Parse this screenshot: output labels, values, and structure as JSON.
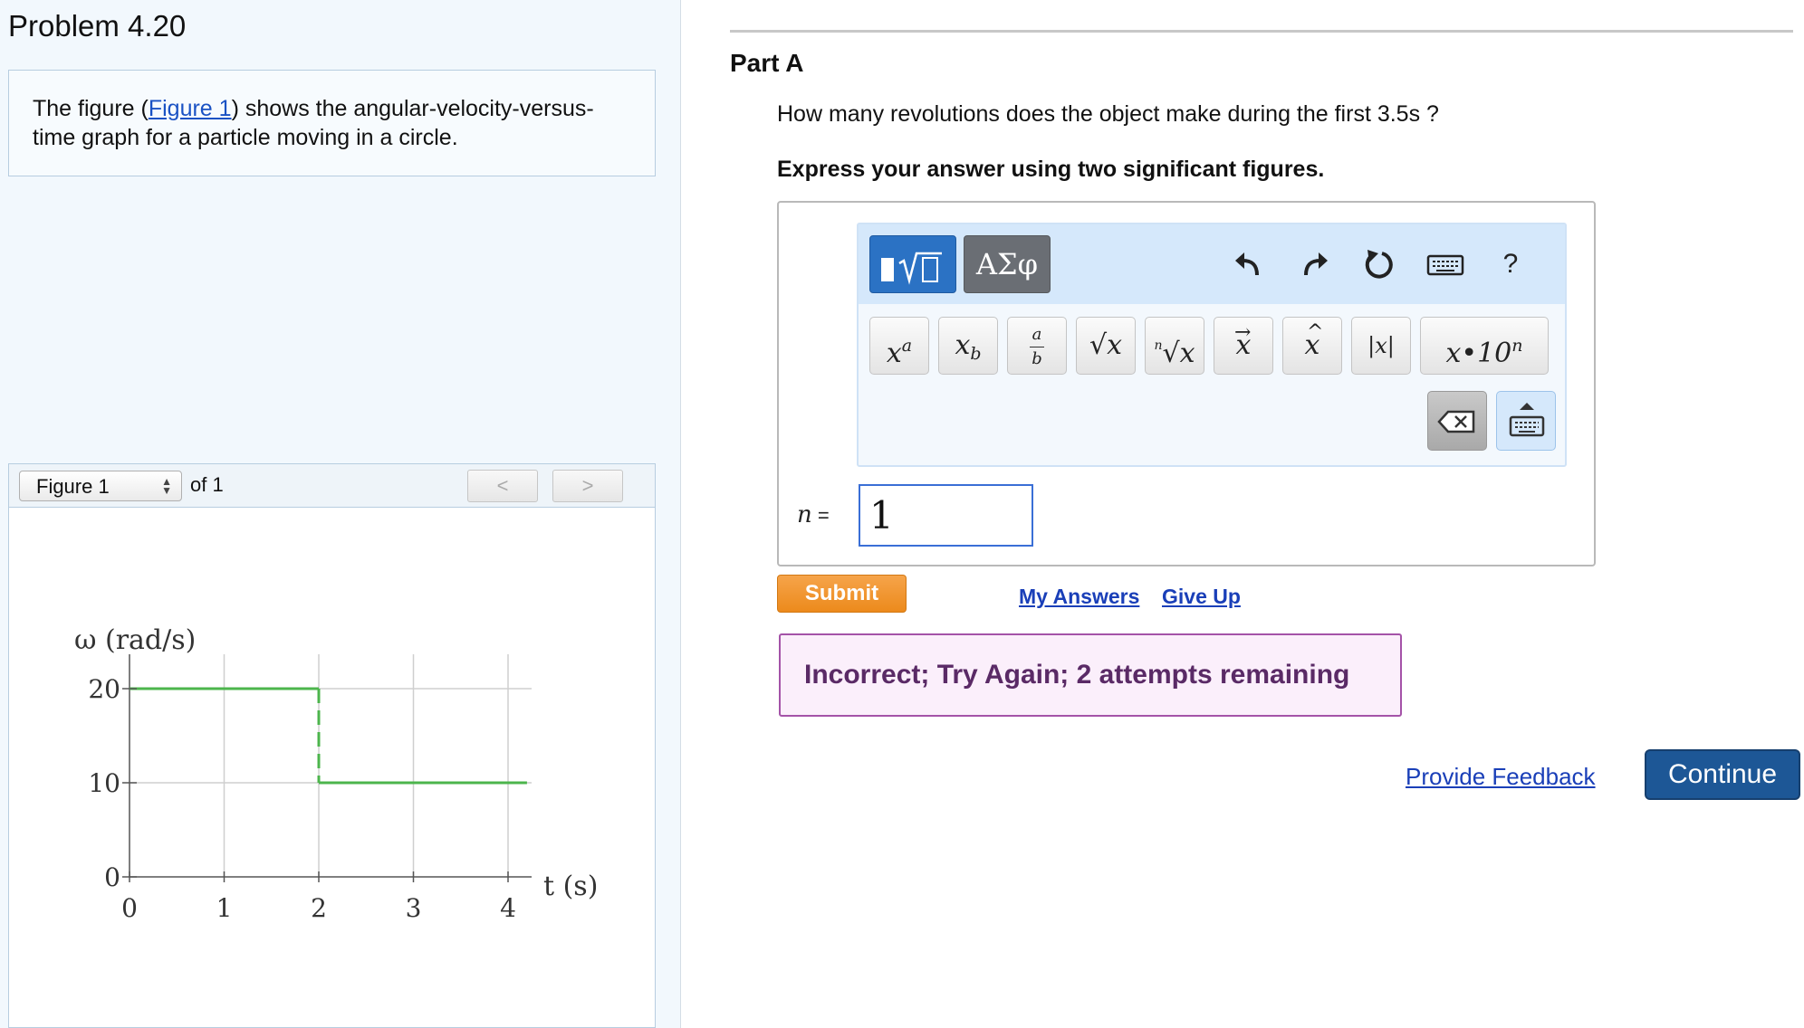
{
  "problem": {
    "title": "Problem 4.20",
    "intro_before": "The figure (",
    "intro_link": "Figure 1",
    "intro_after": ") shows the angular-velocity-versus-time graph for a particle moving in a circle."
  },
  "figure_panel": {
    "selected": "Figure 1",
    "of_text": "of 1",
    "prev_icon": "chevron-left-icon",
    "next_icon": "chevron-right-icon"
  },
  "chart_data": {
    "type": "line",
    "ylabel": "ω (rad/s)",
    "xlabel": "t (s)",
    "xlim": [
      0,
      4
    ],
    "ylim": [
      0,
      20
    ],
    "x_ticks": [
      "0",
      "1",
      "2",
      "3",
      "4"
    ],
    "y_ticks": [
      "0",
      "10",
      "20"
    ],
    "grid": true,
    "series": [
      {
        "x": [
          0,
          2,
          2,
          4.2
        ],
        "y": [
          20,
          20,
          10,
          10
        ],
        "color": "#4cb54c"
      }
    ]
  },
  "part": {
    "title": "Part A",
    "question": "How many revolutions does the object make during the first 3.5s ?",
    "instruction": "Express your answer using two significant figures."
  },
  "editor": {
    "greek_label": "ΑΣφ",
    "tool_icons": [
      "undo-icon",
      "redo-icon",
      "reset-icon",
      "keyboard-icon",
      "help-icon"
    ],
    "help_label": "?",
    "keys": {
      "power": "x",
      "power_sup": "a",
      "subscript": "x",
      "subscript_sub": "b",
      "fraction_num": "a",
      "fraction_den": "b",
      "sqrt": "√x",
      "nthroot_index": "n",
      "nthroot": "√x",
      "vector": "x",
      "unit_vector": "x",
      "abs": "|x|",
      "sci": "x•10",
      "sci_sup": "n"
    }
  },
  "answer": {
    "label_var": "n",
    "label_eq": " =",
    "value": "1"
  },
  "buttons": {
    "submit": "Submit",
    "my_answers": "My Answers",
    "give_up": "Give Up",
    "provide_feedback": "Provide Feedback",
    "continue": "Continue"
  },
  "feedback": {
    "message": "Incorrect; Try Again; 2 attempts remaining"
  },
  "colors": {
    "accent_blue": "#2b72c4",
    "submit_orange": "#ec8a1c",
    "feedback_border": "#a453a8",
    "continue_blue": "#1d5796"
  }
}
